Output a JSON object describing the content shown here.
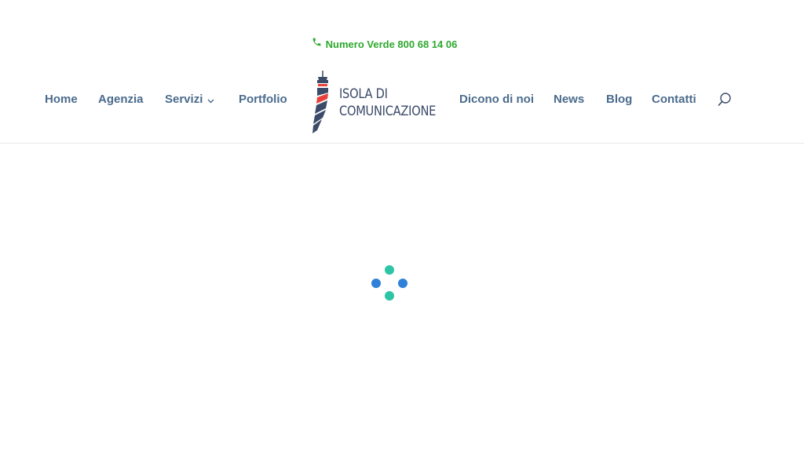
{
  "topbar": {
    "phone_icon": "phone-icon",
    "phone_text": "Numero Verde 800 68 14 06"
  },
  "nav": {
    "left": [
      {
        "label": "Home"
      },
      {
        "label": "Agenzia"
      },
      {
        "label": "Servizi",
        "has_dropdown": true
      },
      {
        "label": "Portfolio"
      }
    ],
    "right": [
      {
        "label": "Dicono di noi"
      },
      {
        "label": "News"
      },
      {
        "label": "Blog"
      },
      {
        "label": "Contatti"
      }
    ]
  },
  "logo": {
    "line1": "ISOLA DI",
    "line2": "COMUNICAZIONE",
    "icon": "lighthouse-icon"
  },
  "search": {
    "icon": "search-icon"
  },
  "loader": {
    "icon": "loading-spinner-icon"
  },
  "colors": {
    "nav_text": "#4a6b8c",
    "phone_green": "#2ea82e",
    "logo_navy": "#3a4a68",
    "logo_red": "#e8413c",
    "loader_teal": "#2ec4a6",
    "loader_blue": "#2f80d8"
  }
}
